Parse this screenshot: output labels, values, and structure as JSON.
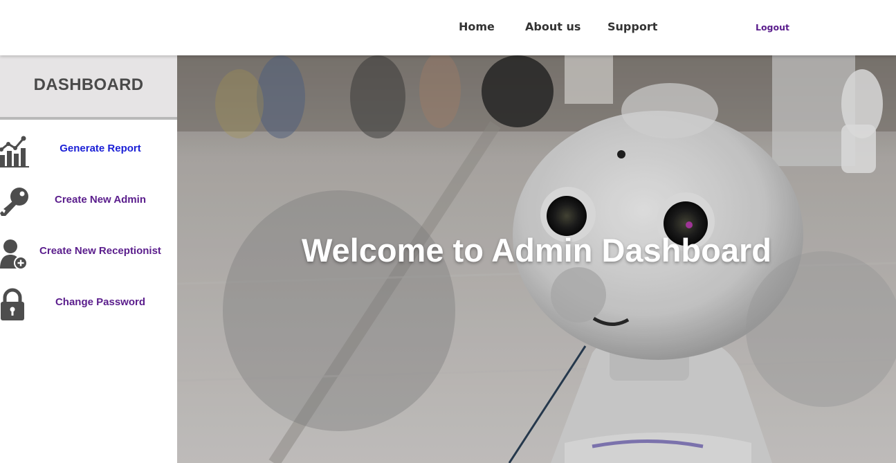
{
  "nav": {
    "home": "Home",
    "about": "About us",
    "support": "Support",
    "logout": "Logout"
  },
  "sidebar": {
    "title": "DASHBOARD",
    "items": [
      {
        "label": "Generate Report",
        "icon": "chart-icon"
      },
      {
        "label": "Create New Admin",
        "icon": "key-icon"
      },
      {
        "label": "Create New Receptionist",
        "icon": "user-plus-icon"
      },
      {
        "label": "Change Password",
        "icon": "lock-icon"
      }
    ]
  },
  "hero": {
    "title": "Welcome to Admin Dashboard"
  },
  "colors": {
    "nav_text": "#333333",
    "logout": "#5a1d8c",
    "menu_link": "#5a1d8c",
    "menu_active": "#1a1fd6",
    "sidebar_header_bg": "#e6e4e5"
  }
}
